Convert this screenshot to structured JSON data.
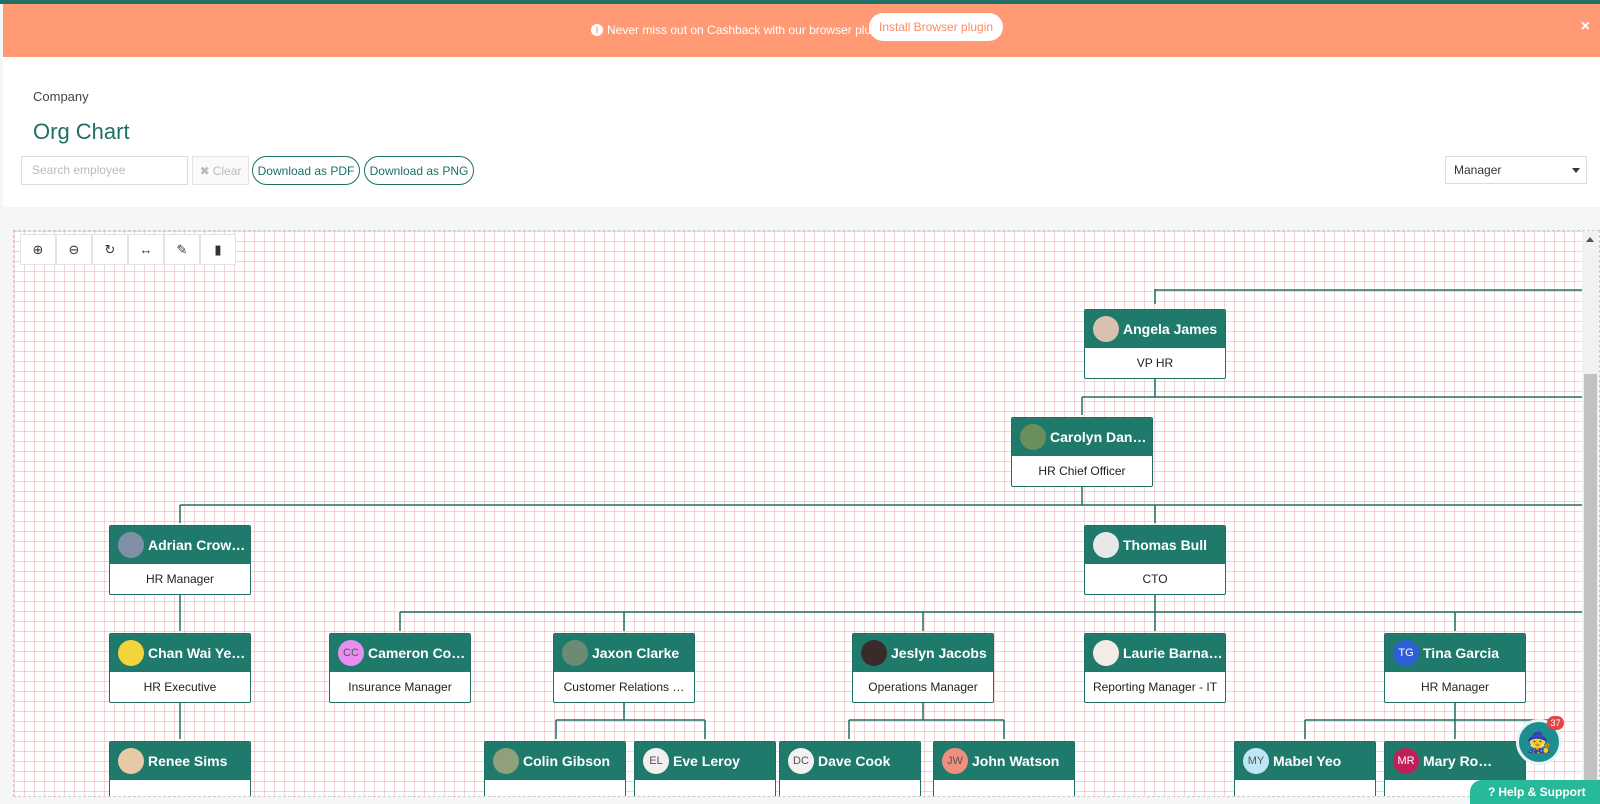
{
  "banner": {
    "message": "Never miss out on Cashback with our browser plugin",
    "install_label": "Install Browser plugin",
    "close_label": "×",
    "bg_color": "#ff9a74"
  },
  "header": {
    "breadcrumb": "Company",
    "title": "Org Chart",
    "search_placeholder": "Search employee",
    "clear_label": "Clear",
    "download_pdf_label": "Download as PDF",
    "download_png_label": "Download as PNG",
    "view_select_value": "Manager"
  },
  "toolbar": {
    "icons": [
      "zoom-in-icon",
      "zoom-out-icon",
      "refresh-icon",
      "fit-width-icon",
      "edit-icon",
      "export-icon"
    ]
  },
  "org": {
    "people": [
      {
        "id": "angela",
        "name": "Angela James",
        "role": "VP HR",
        "avatar": "photo"
      },
      {
        "id": "carolyn",
        "name": "Carolyn Dani…",
        "role": "HR Chief Officer",
        "avatar": "photo"
      },
      {
        "id": "adrian",
        "name": "Adrian Crowl…",
        "role": "HR Manager",
        "avatar": "photo"
      },
      {
        "id": "thomas",
        "name": "Thomas Bull",
        "role": "CTO",
        "avatar": "photo"
      },
      {
        "id": "chan",
        "name": "Chan Wai Ye…",
        "role": "HR Executive",
        "avatar": "photo"
      },
      {
        "id": "cameron",
        "name": "Cameron Co…",
        "role": "Insurance Manager",
        "avatar": "CC"
      },
      {
        "id": "jaxon",
        "name": "Jaxon Clarke",
        "role": "Customer Relations …",
        "avatar": "photo"
      },
      {
        "id": "jeslyn",
        "name": "Jeslyn Jacobs",
        "role": "Operations Manager",
        "avatar": "photo"
      },
      {
        "id": "laurie",
        "name": "Laurie Barna…",
        "role": "Reporting Manager - IT",
        "avatar": "photo"
      },
      {
        "id": "tina",
        "name": "Tina Garcia",
        "role": "HR Manager",
        "avatar": "TG"
      },
      {
        "id": "renee",
        "name": "Renee Sims",
        "role": "",
        "avatar": "photo"
      },
      {
        "id": "colin",
        "name": "Colin Gibson",
        "role": "",
        "avatar": "photo"
      },
      {
        "id": "eve",
        "name": "Eve Leroy",
        "role": "",
        "avatar": "EL"
      },
      {
        "id": "dave",
        "name": "Dave Cook",
        "role": "",
        "avatar": "DC"
      },
      {
        "id": "john",
        "name": "John Watson",
        "role": "",
        "avatar": "JW"
      },
      {
        "id": "mabel",
        "name": "Mabel Yeo",
        "role": "",
        "avatar": "MY"
      },
      {
        "id": "mary",
        "name": "Mary Ro…",
        "role": "",
        "avatar": "MR"
      }
    ]
  },
  "help": {
    "label": "Help & Support",
    "badge_count": "37"
  },
  "colors": {
    "brand": "#1f7a6c",
    "accent": "#26b99a"
  }
}
